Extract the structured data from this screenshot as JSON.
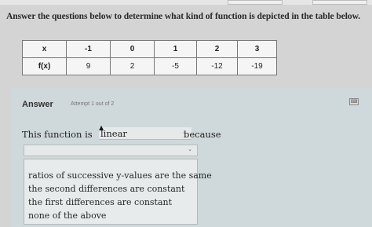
{
  "question": "Answer the questions below to determine what kind of function is depicted in the table below.",
  "table": {
    "rows": [
      {
        "header": "x",
        "cells": [
          "-1",
          "0",
          "1",
          "2",
          "3"
        ]
      },
      {
        "header": "f(x)",
        "cells": [
          "9",
          "2",
          "-5",
          "-12",
          "-19"
        ]
      }
    ]
  },
  "answer": {
    "label": "Answer",
    "attempt": "Attempt 1 out of 2",
    "sentence_prefix": "This function is",
    "function_type": "linear",
    "because": "because",
    "reason_value": "",
    "options": [
      "ratios of successive y-values are the same",
      "the second differences are constant",
      "the first differences are constant",
      "none of the above"
    ]
  },
  "icons": {
    "dropdown": "chevron-down-icon",
    "corner": "keyboard-icon",
    "cursor": "mouse-cursor-icon"
  }
}
